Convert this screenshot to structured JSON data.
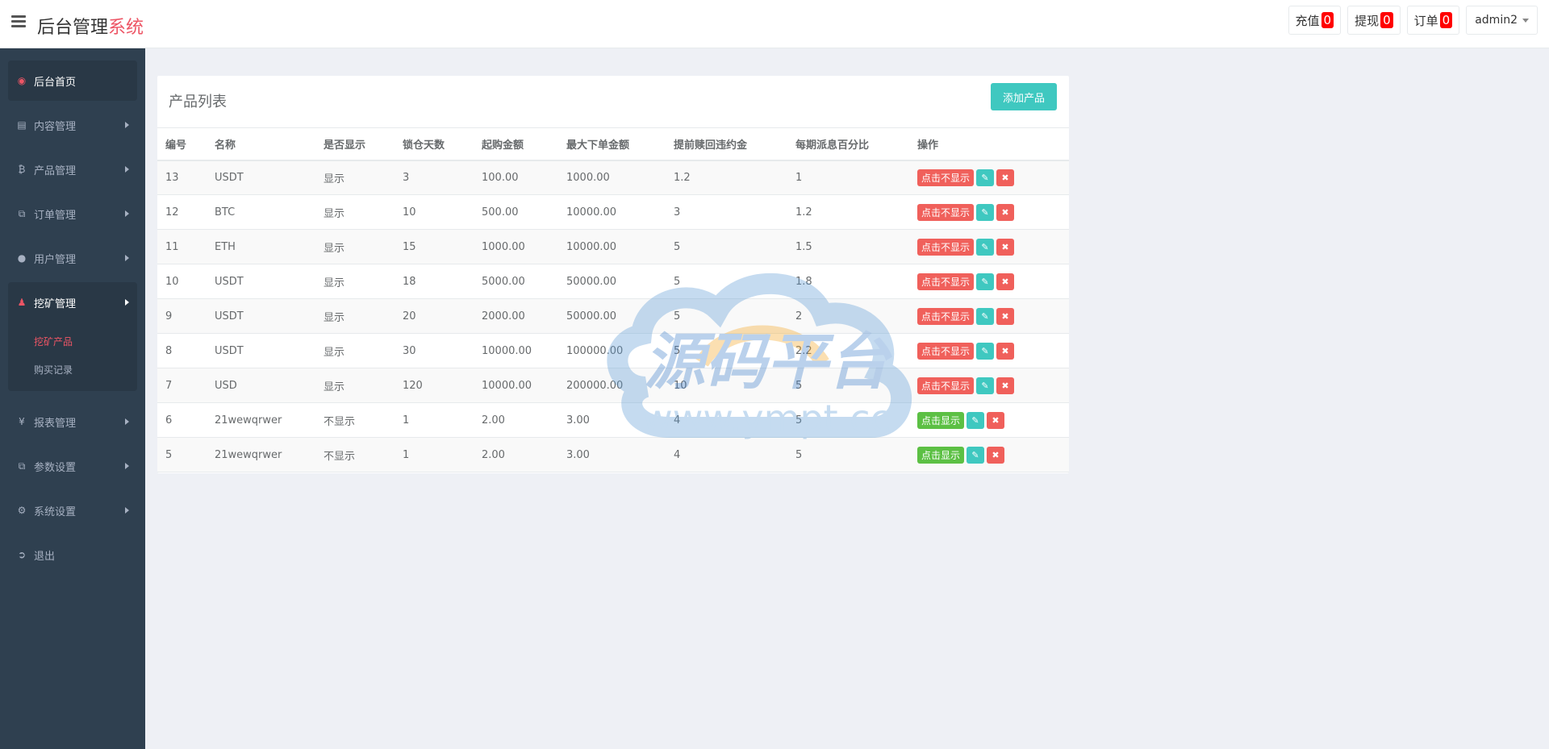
{
  "header": {
    "brand_main": "后台管理",
    "brand_accent": "系统",
    "buttons": [
      {
        "label": "充值",
        "count": "0"
      },
      {
        "label": "提现",
        "count": "0"
      },
      {
        "label": "订单",
        "count": "0"
      }
    ],
    "user": "admin2"
  },
  "sidebar": {
    "items": [
      {
        "label": "后台首页",
        "icon": "dashboard-icon"
      },
      {
        "label": "内容管理",
        "icon": "book-icon"
      },
      {
        "label": "产品管理",
        "icon": "bitcoin-icon"
      },
      {
        "label": "订单管理",
        "icon": "copy-icon"
      },
      {
        "label": "用户管理",
        "icon": "user-icon"
      },
      {
        "label": "挖矿管理",
        "icon": "user-secret-icon"
      },
      {
        "label": "报表管理",
        "icon": "yen-icon"
      },
      {
        "label": "参数设置",
        "icon": "copy-icon"
      },
      {
        "label": "系统设置",
        "icon": "cogs-icon"
      },
      {
        "label": "退出",
        "icon": "sign-out-icon"
      }
    ],
    "submenu": [
      {
        "label": "挖矿产品"
      },
      {
        "label": "购买记录"
      }
    ]
  },
  "panel": {
    "title": "产品列表",
    "add_label": "添加产品"
  },
  "table": {
    "headers": [
      "编号",
      "名称",
      "是否显示",
      "锁仓天数",
      "起购金额",
      "最大下单金额",
      "提前赎回违约金",
      "每期派息百分比",
      "操作"
    ],
    "rows": [
      {
        "id": "13",
        "name": "USDT",
        "show": "显示",
        "days": "3",
        "min": "100.00",
        "max": "1000.00",
        "penalty": "1.2",
        "rate": "1",
        "toggle": "点击不显示"
      },
      {
        "id": "12",
        "name": "BTC",
        "show": "显示",
        "days": "10",
        "min": "500.00",
        "max": "10000.00",
        "penalty": "3",
        "rate": "1.2",
        "toggle": "点击不显示"
      },
      {
        "id": "11",
        "name": "ETH",
        "show": "显示",
        "days": "15",
        "min": "1000.00",
        "max": "10000.00",
        "penalty": "5",
        "rate": "1.5",
        "toggle": "点击不显示"
      },
      {
        "id": "10",
        "name": "USDT",
        "show": "显示",
        "days": "18",
        "min": "5000.00",
        "max": "50000.00",
        "penalty": "5",
        "rate": "1.8",
        "toggle": "点击不显示"
      },
      {
        "id": "9",
        "name": "USDT",
        "show": "显示",
        "days": "20",
        "min": "2000.00",
        "max": "50000.00",
        "penalty": "5",
        "rate": "2",
        "toggle": "点击不显示"
      },
      {
        "id": "8",
        "name": "USDT",
        "show": "显示",
        "days": "30",
        "min": "10000.00",
        "max": "100000.00",
        "penalty": "5",
        "rate": "2.2",
        "toggle": "点击不显示"
      },
      {
        "id": "7",
        "name": "USD",
        "show": "显示",
        "days": "120",
        "min": "10000.00",
        "max": "200000.00",
        "penalty": "10",
        "rate": "5",
        "toggle": "点击不显示"
      },
      {
        "id": "6",
        "name": "21wewqrwer",
        "show": "不显示",
        "days": "1",
        "min": "2.00",
        "max": "3.00",
        "penalty": "4",
        "rate": "5",
        "toggle": "点击显示"
      },
      {
        "id": "5",
        "name": "21wewqrwer",
        "show": "不显示",
        "days": "1",
        "min": "2.00",
        "max": "3.00",
        "penalty": "4",
        "rate": "5",
        "toggle": "点击显示"
      }
    ]
  },
  "watermark": {
    "title": "源码平台",
    "url": "www.ympt.cc"
  },
  "colors": {
    "sidebar": "#2f4050",
    "accent": "#ed5565",
    "teal": "#3fc8c0",
    "green": "#5cc044",
    "red": "#f0605b"
  }
}
